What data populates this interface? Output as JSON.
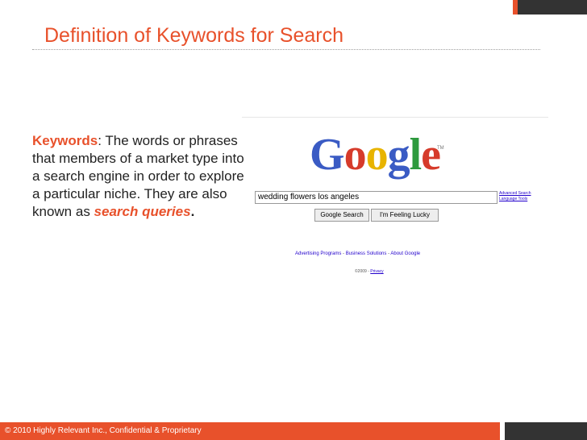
{
  "slide": {
    "title": "Definition of Keywords for Search",
    "body": {
      "term": "Keywords",
      "definition": ": The words or phrases that members of a market type into a search engine in order to explore a particular niche. They are also known as ",
      "highlight": "search queries",
      "end": "."
    },
    "footer": "© 2010 Highly Relevant Inc., Confidential & Proprietary"
  },
  "google_screenshot": {
    "logo_letters": [
      {
        "char": "G",
        "color": "#3a5bc4"
      },
      {
        "char": "o",
        "color": "#d63b2b"
      },
      {
        "char": "o",
        "color": "#e8b400"
      },
      {
        "char": "g",
        "color": "#3a5bc4"
      },
      {
        "char": "l",
        "color": "#2e9a3e"
      },
      {
        "char": "e",
        "color": "#d63b2b"
      }
    ],
    "trademark": "TM",
    "search_query": "wedding flowers los angeles",
    "advanced_search": "Advanced Search",
    "language_tools": "Language Tools",
    "search_button": "Google Search",
    "lucky_button": "I'm Feeling Lucky",
    "links": {
      "advertising": "Advertising Programs",
      "business": "Business Solutions",
      "about": "About Google",
      "separator": " - "
    },
    "copyright": "©2009 - ",
    "privacy": "Privacy"
  },
  "colors": {
    "accent": "#e8512b",
    "dark": "#333333",
    "link": "#2200cc"
  }
}
